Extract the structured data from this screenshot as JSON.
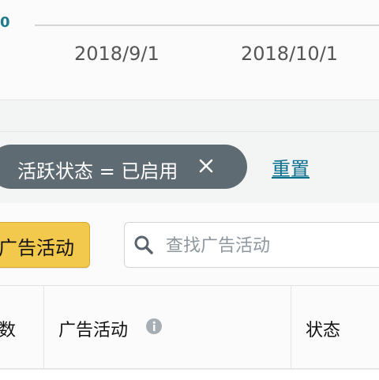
{
  "chart": {
    "y_tick_fragment": "0",
    "x_ticks": [
      "2018/9/1",
      "2018/10/1"
    ]
  },
  "filters": {
    "chip_label": "活跃状态 = 已启用",
    "reset_label": "重置"
  },
  "toolbar": {
    "create_button_label": "广告活动",
    "search_placeholder": "查找广告活动"
  },
  "table": {
    "headers": [
      "数",
      "广告活动",
      "状态"
    ]
  }
}
